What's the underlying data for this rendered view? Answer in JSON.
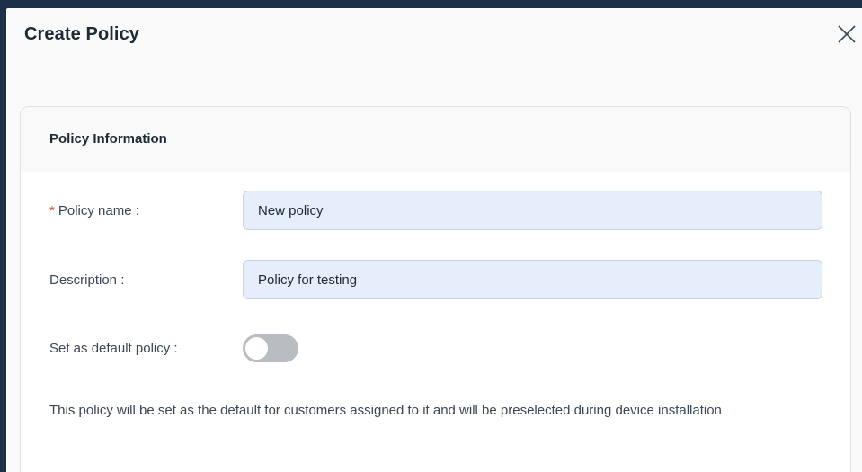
{
  "dialog": {
    "title": "Create Policy",
    "close_icon": "close-icon"
  },
  "section": {
    "title": "Policy Information"
  },
  "fields": {
    "policy_name": {
      "required_mark": "*",
      "label": "Policy name",
      "colon": ":",
      "value": "New policy"
    },
    "description": {
      "label": "Description",
      "colon": ":",
      "value": "Policy for testing"
    },
    "default_policy": {
      "label": "Set as default policy",
      "colon": ":",
      "enabled": false
    }
  },
  "help_text": "This policy will be set as the default for customers assigned to it and will be preselected during device installation",
  "colors": {
    "backdrop": "#1c3149",
    "input_bg": "#e5eefa",
    "required": "#e0452f",
    "toggle_off": "#b9bcc1"
  }
}
